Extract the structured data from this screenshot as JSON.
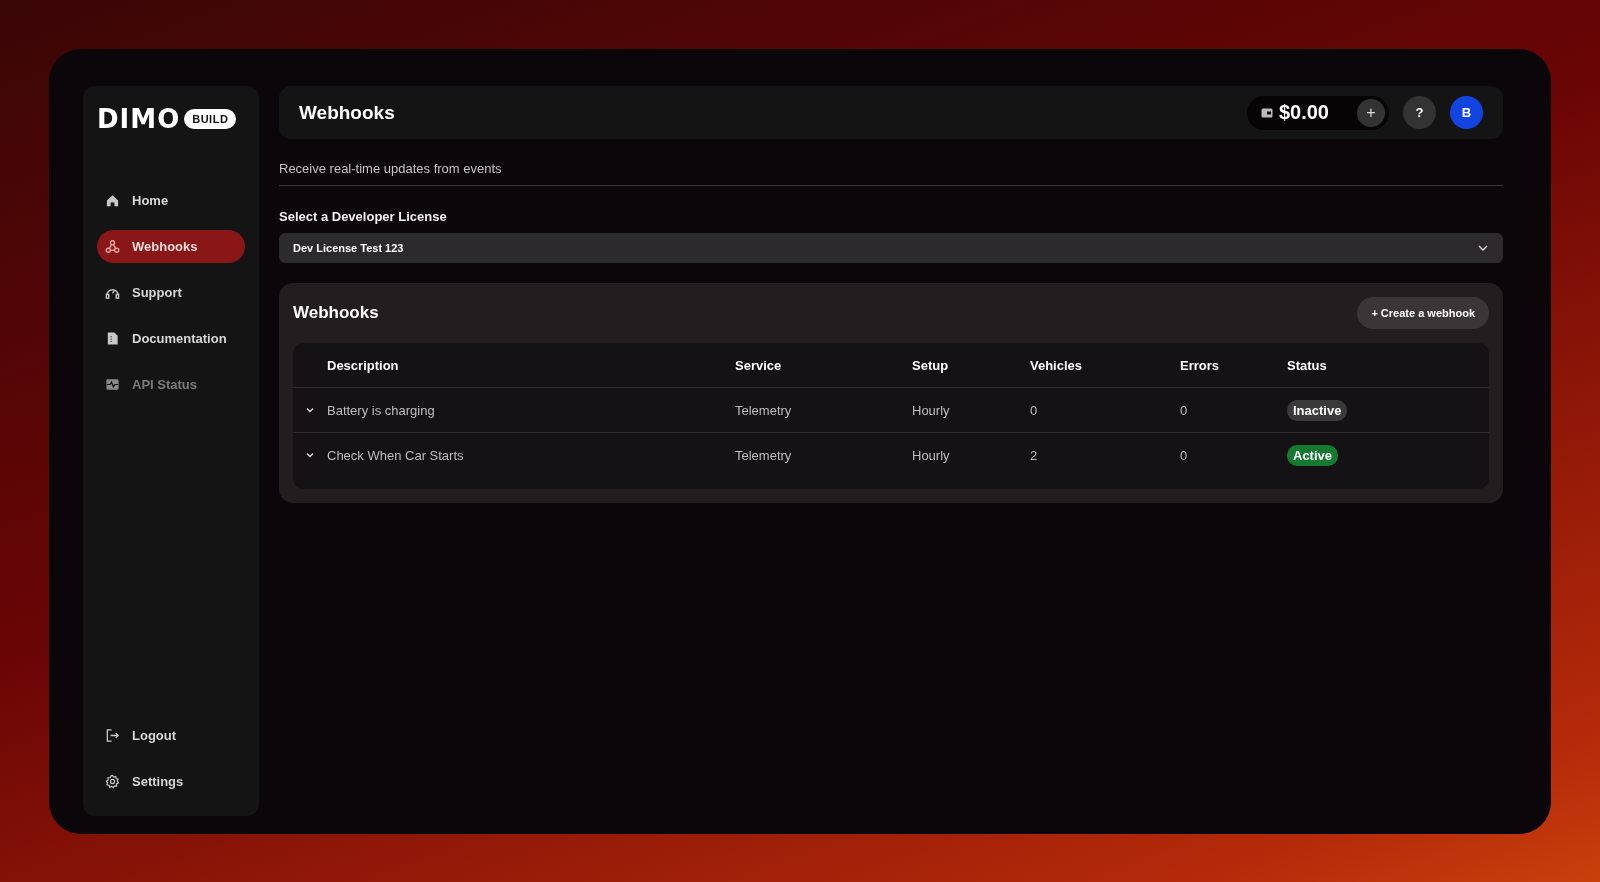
{
  "logo": {
    "wordmark": "DIMO",
    "badge": "BUILD"
  },
  "sidebar": {
    "items": [
      {
        "label": "Home",
        "kind": "home",
        "selected": false,
        "disabled": false
      },
      {
        "label": "Webhooks",
        "kind": "webhooks",
        "selected": true,
        "disabled": false
      },
      {
        "label": "Support",
        "kind": "support",
        "selected": false,
        "disabled": false
      },
      {
        "label": "Documentation",
        "kind": "doc",
        "selected": false,
        "disabled": false
      },
      {
        "label": "API Status",
        "kind": "status",
        "selected": false,
        "disabled": true
      }
    ],
    "footer_items": [
      {
        "label": "Logout",
        "kind": "logout"
      },
      {
        "label": "Settings",
        "kind": "gear"
      }
    ]
  },
  "header": {
    "title": "Webhooks",
    "balance": "$0.00",
    "add": "+",
    "help": "?",
    "avatar": "B"
  },
  "subtitle": "Receive real-time updates from events",
  "license": {
    "label": "Select a Developer License",
    "value": "Dev License Test 123"
  },
  "webhooks_card": {
    "title": "Webhooks",
    "create_button": "+ Create a webhook",
    "table": {
      "columns": [
        "Description",
        "Service",
        "Setup",
        "Vehicles",
        "Errors",
        "Status"
      ],
      "rows": [
        {
          "description": "Battery is charging",
          "service": "Telemetry",
          "setup": "Hourly",
          "vehicles": "0",
          "errors": "0",
          "status": "Inactive",
          "active": false
        },
        {
          "description": "Check When Car Starts",
          "service": "Telemetry",
          "setup": "Hourly",
          "vehicles": "2",
          "errors": "0",
          "status": "Active",
          "active": true
        }
      ]
    }
  }
}
